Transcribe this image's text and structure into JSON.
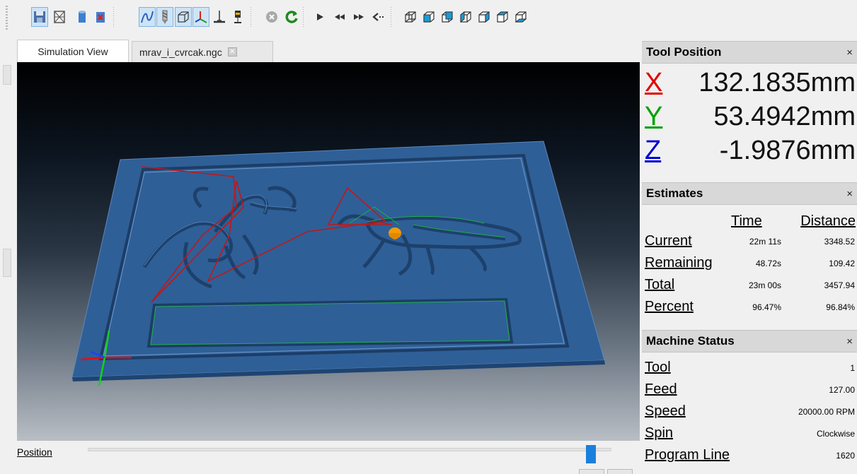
{
  "toolbar": {
    "icons": [
      "save-icon",
      "wireframe-icon",
      "stock-icon",
      "remove-stock-icon",
      "toolpath-icon",
      "tool-icon",
      "box-icon",
      "axes-icon",
      "ground-icon",
      "spindle-icon",
      "stop-icon",
      "restart-icon",
      "play-icon",
      "rewind-icon",
      "fast-forward-icon",
      "step-back-icon",
      "view-iso-icon",
      "view-front-icon",
      "view-back-icon",
      "view-left-icon",
      "view-right-icon",
      "view-top-icon",
      "view-bottom-icon"
    ],
    "accent": "#1b7fdc"
  },
  "tabs": [
    {
      "label": "Simulation View"
    },
    {
      "label": "mrav_i_cvrcak.ngc"
    }
  ],
  "position_bar": {
    "label": "Position",
    "progress": 0.96
  },
  "tool_position": {
    "title": "Tool Position",
    "x_label": "X",
    "x_value": "132.1835mm",
    "x_color": "#e00000",
    "y_label": "Y",
    "y_value": "53.4942mm",
    "y_color": "#00a000",
    "z_label": "Z",
    "z_value": "-1.9876mm",
    "z_color": "#0000d0"
  },
  "estimates": {
    "title": "Estimates",
    "col_time": "Time",
    "col_distance": "Distance",
    "rows": [
      {
        "label": "Current",
        "time": "22m 11s",
        "distance": "3348.52"
      },
      {
        "label": "Remaining",
        "time": "48.72s",
        "distance": "109.42"
      },
      {
        "label": "Total",
        "time": "23m 00s",
        "distance": "3457.94"
      },
      {
        "label": "Percent",
        "time": "96.47%",
        "distance": "96.84%"
      }
    ]
  },
  "machine_status": {
    "title": "Machine Status",
    "rows": [
      {
        "label": "Tool",
        "value": "1"
      },
      {
        "label": "Feed",
        "value": "127.00"
      },
      {
        "label": "Speed",
        "value": "20000.00 RPM"
      },
      {
        "label": "Spin",
        "value": "Clockwise"
      },
      {
        "label": "Program Line",
        "value": "1620"
      }
    ]
  },
  "close_glyph": "×"
}
